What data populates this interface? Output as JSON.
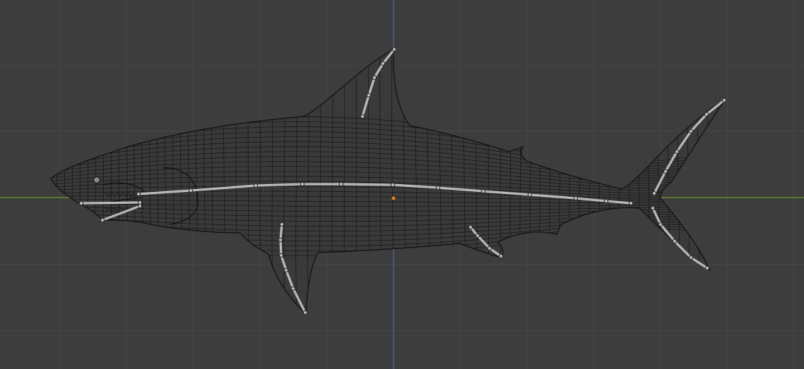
{
  "viewport": {
    "mode": "wireframe",
    "background_color": "#3d3d3d",
    "grid_color": "#474747",
    "x_axis_color": "#6e9a2e",
    "y_axis_color": "#3d6fb5",
    "origin_color": "#e8801e"
  },
  "object": {
    "name": "shark",
    "mesh_color": "#141414"
  },
  "armature": {
    "spine_active_color": "#7fd68a",
    "bone_color": "#d8d8d8",
    "joint_color": "#bdbdbd",
    "chains": [
      "spine",
      "dorsal-fin",
      "tail-upper",
      "tail-lower",
      "pectoral-fin",
      "pelvic-fin",
      "jaw-upper",
      "jaw-lower"
    ]
  }
}
